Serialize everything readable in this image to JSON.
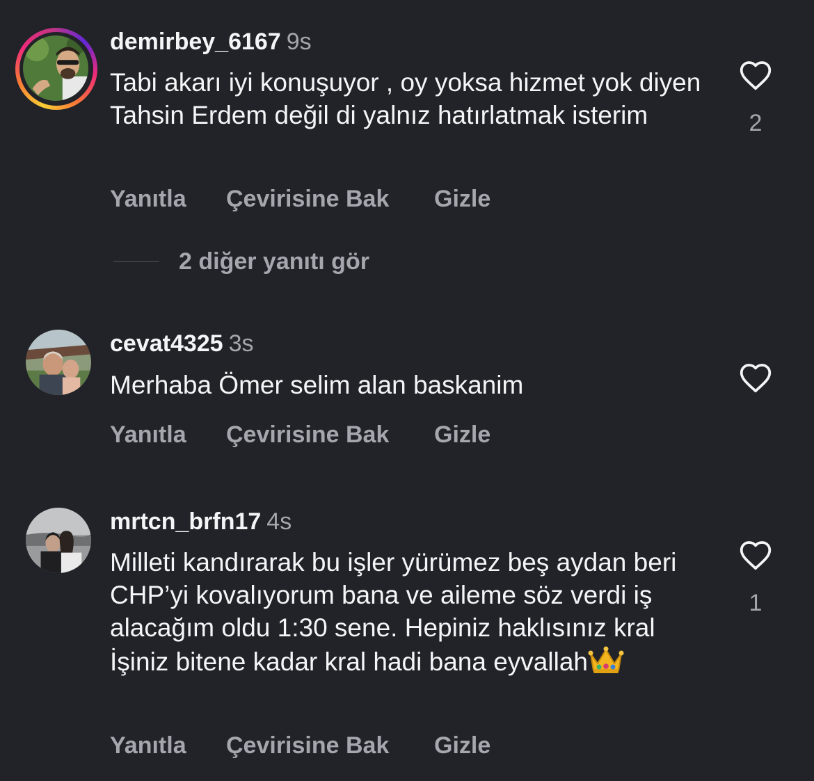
{
  "comments": [
    {
      "username": "demirbey_6167",
      "time": "9s",
      "text": "Tabi akarı iyi konuşuyor , oy yoksa hizmet yok diyen Tahsin Erdem değil di yalnız hatırlatmak isterim",
      "likes": "2",
      "avatar_icon": "avatar-photo-icon",
      "has_story_ring": true,
      "actions": {
        "reply": "Yanıtla",
        "translate": "Çevirisine Bak",
        "hide": "Gizle"
      },
      "view_replies": "2 diğer yanıtı gör"
    },
    {
      "username": "cevat4325",
      "time": "3s",
      "text": "Merhaba Ömer selim alan baskanim",
      "likes": "",
      "avatar_icon": "avatar-photo-icon",
      "actions": {
        "reply": "Yanıtla",
        "translate": "Çevirisine Bak",
        "hide": "Gizle"
      }
    },
    {
      "username": "mrtcn_brfn17",
      "time": "4s",
      "text": "Milleti kandırarak bu işler yürümez beş aydan beri CHP’yi kovalıyorum bana ve aileme söz verdi iş alacağım oldu 1:30 sene. Hepiniz haklısınız kral İşiniz bitene kadar kral hadi bana eyvallah",
      "emoji": "crown-emoji-icon",
      "likes": "1",
      "avatar_icon": "avatar-photo-icon",
      "actions": {
        "reply": "Yanıtla",
        "translate": "Çevirisine Bak",
        "hide": "Gizle"
      }
    }
  ],
  "colors": {
    "background": "#212328",
    "primary_text": "#f4f5f7",
    "secondary_text": "#a4a7ad"
  },
  "icons": {
    "like": "heart-outline-icon"
  }
}
